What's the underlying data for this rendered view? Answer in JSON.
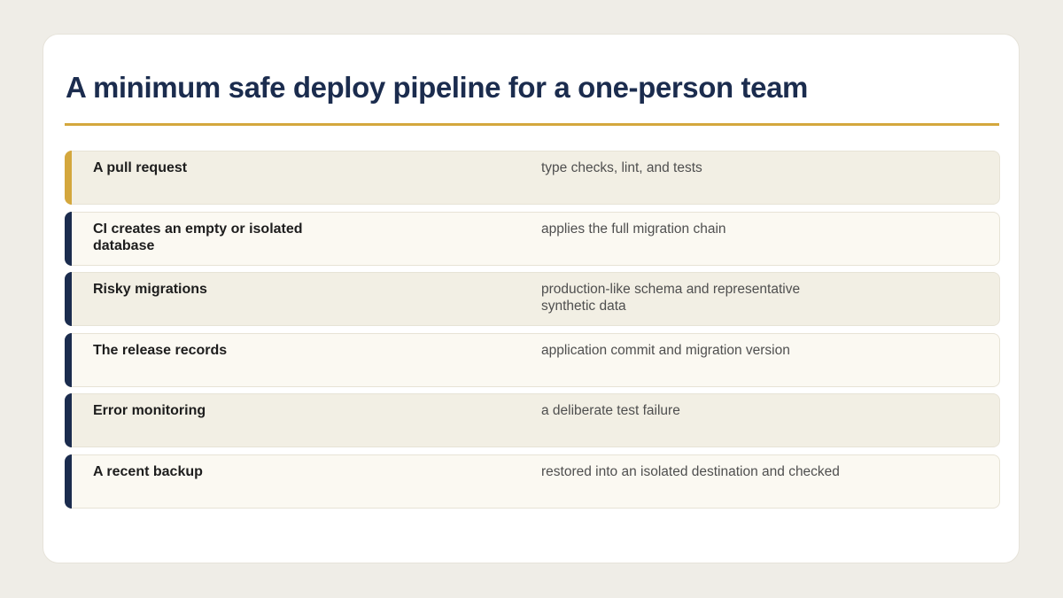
{
  "title": "A minimum safe deploy pipeline for a one-person team",
  "colors": {
    "accent": "#d4a73d",
    "navy": "#1b2c4e",
    "background": "#efede7"
  },
  "rows": [
    {
      "left": "A pull request",
      "right": "type checks, lint, and tests"
    },
    {
      "left": "CI creates an empty or isolated database",
      "right": "applies the full migration chain"
    },
    {
      "left": "Risky migrations",
      "right": "production-like schema and representative synthetic data"
    },
    {
      "left": "The release records",
      "right": "application commit and migration version"
    },
    {
      "left": "Error monitoring",
      "right": "a deliberate test failure"
    },
    {
      "left": "A recent backup",
      "right": "restored into an isolated destination and checked"
    }
  ]
}
